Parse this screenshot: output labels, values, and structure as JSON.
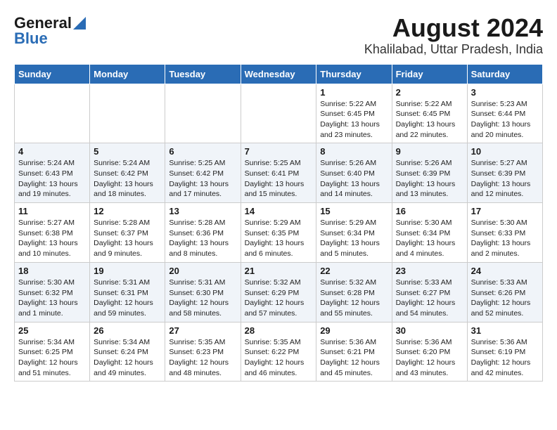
{
  "logo": {
    "line1": "General",
    "line2": "Blue"
  },
  "title": "August 2024",
  "subtitle": "Khalilabad, Uttar Pradesh, India",
  "days_of_week": [
    "Sunday",
    "Monday",
    "Tuesday",
    "Wednesday",
    "Thursday",
    "Friday",
    "Saturday"
  ],
  "weeks": [
    [
      {
        "day": "",
        "info": ""
      },
      {
        "day": "",
        "info": ""
      },
      {
        "day": "",
        "info": ""
      },
      {
        "day": "",
        "info": ""
      },
      {
        "day": "1",
        "info": "Sunrise: 5:22 AM\nSunset: 6:45 PM\nDaylight: 13 hours and 23 minutes."
      },
      {
        "day": "2",
        "info": "Sunrise: 5:22 AM\nSunset: 6:45 PM\nDaylight: 13 hours and 22 minutes."
      },
      {
        "day": "3",
        "info": "Sunrise: 5:23 AM\nSunset: 6:44 PM\nDaylight: 13 hours and 20 minutes."
      }
    ],
    [
      {
        "day": "4",
        "info": "Sunrise: 5:24 AM\nSunset: 6:43 PM\nDaylight: 13 hours and 19 minutes."
      },
      {
        "day": "5",
        "info": "Sunrise: 5:24 AM\nSunset: 6:42 PM\nDaylight: 13 hours and 18 minutes."
      },
      {
        "day": "6",
        "info": "Sunrise: 5:25 AM\nSunset: 6:42 PM\nDaylight: 13 hours and 17 minutes."
      },
      {
        "day": "7",
        "info": "Sunrise: 5:25 AM\nSunset: 6:41 PM\nDaylight: 13 hours and 15 minutes."
      },
      {
        "day": "8",
        "info": "Sunrise: 5:26 AM\nSunset: 6:40 PM\nDaylight: 13 hours and 14 minutes."
      },
      {
        "day": "9",
        "info": "Sunrise: 5:26 AM\nSunset: 6:39 PM\nDaylight: 13 hours and 13 minutes."
      },
      {
        "day": "10",
        "info": "Sunrise: 5:27 AM\nSunset: 6:39 PM\nDaylight: 13 hours and 12 minutes."
      }
    ],
    [
      {
        "day": "11",
        "info": "Sunrise: 5:27 AM\nSunset: 6:38 PM\nDaylight: 13 hours and 10 minutes."
      },
      {
        "day": "12",
        "info": "Sunrise: 5:28 AM\nSunset: 6:37 PM\nDaylight: 13 hours and 9 minutes."
      },
      {
        "day": "13",
        "info": "Sunrise: 5:28 AM\nSunset: 6:36 PM\nDaylight: 13 hours and 8 minutes."
      },
      {
        "day": "14",
        "info": "Sunrise: 5:29 AM\nSunset: 6:35 PM\nDaylight: 13 hours and 6 minutes."
      },
      {
        "day": "15",
        "info": "Sunrise: 5:29 AM\nSunset: 6:34 PM\nDaylight: 13 hours and 5 minutes."
      },
      {
        "day": "16",
        "info": "Sunrise: 5:30 AM\nSunset: 6:34 PM\nDaylight: 13 hours and 4 minutes."
      },
      {
        "day": "17",
        "info": "Sunrise: 5:30 AM\nSunset: 6:33 PM\nDaylight: 13 hours and 2 minutes."
      }
    ],
    [
      {
        "day": "18",
        "info": "Sunrise: 5:30 AM\nSunset: 6:32 PM\nDaylight: 13 hours and 1 minute."
      },
      {
        "day": "19",
        "info": "Sunrise: 5:31 AM\nSunset: 6:31 PM\nDaylight: 12 hours and 59 minutes."
      },
      {
        "day": "20",
        "info": "Sunrise: 5:31 AM\nSunset: 6:30 PM\nDaylight: 12 hours and 58 minutes."
      },
      {
        "day": "21",
        "info": "Sunrise: 5:32 AM\nSunset: 6:29 PM\nDaylight: 12 hours and 57 minutes."
      },
      {
        "day": "22",
        "info": "Sunrise: 5:32 AM\nSunset: 6:28 PM\nDaylight: 12 hours and 55 minutes."
      },
      {
        "day": "23",
        "info": "Sunrise: 5:33 AM\nSunset: 6:27 PM\nDaylight: 12 hours and 54 minutes."
      },
      {
        "day": "24",
        "info": "Sunrise: 5:33 AM\nSunset: 6:26 PM\nDaylight: 12 hours and 52 minutes."
      }
    ],
    [
      {
        "day": "25",
        "info": "Sunrise: 5:34 AM\nSunset: 6:25 PM\nDaylight: 12 hours and 51 minutes."
      },
      {
        "day": "26",
        "info": "Sunrise: 5:34 AM\nSunset: 6:24 PM\nDaylight: 12 hours and 49 minutes."
      },
      {
        "day": "27",
        "info": "Sunrise: 5:35 AM\nSunset: 6:23 PM\nDaylight: 12 hours and 48 minutes."
      },
      {
        "day": "28",
        "info": "Sunrise: 5:35 AM\nSunset: 6:22 PM\nDaylight: 12 hours and 46 minutes."
      },
      {
        "day": "29",
        "info": "Sunrise: 5:36 AM\nSunset: 6:21 PM\nDaylight: 12 hours and 45 minutes."
      },
      {
        "day": "30",
        "info": "Sunrise: 5:36 AM\nSunset: 6:20 PM\nDaylight: 12 hours and 43 minutes."
      },
      {
        "day": "31",
        "info": "Sunrise: 5:36 AM\nSunset: 6:19 PM\nDaylight: 12 hours and 42 minutes."
      }
    ]
  ]
}
